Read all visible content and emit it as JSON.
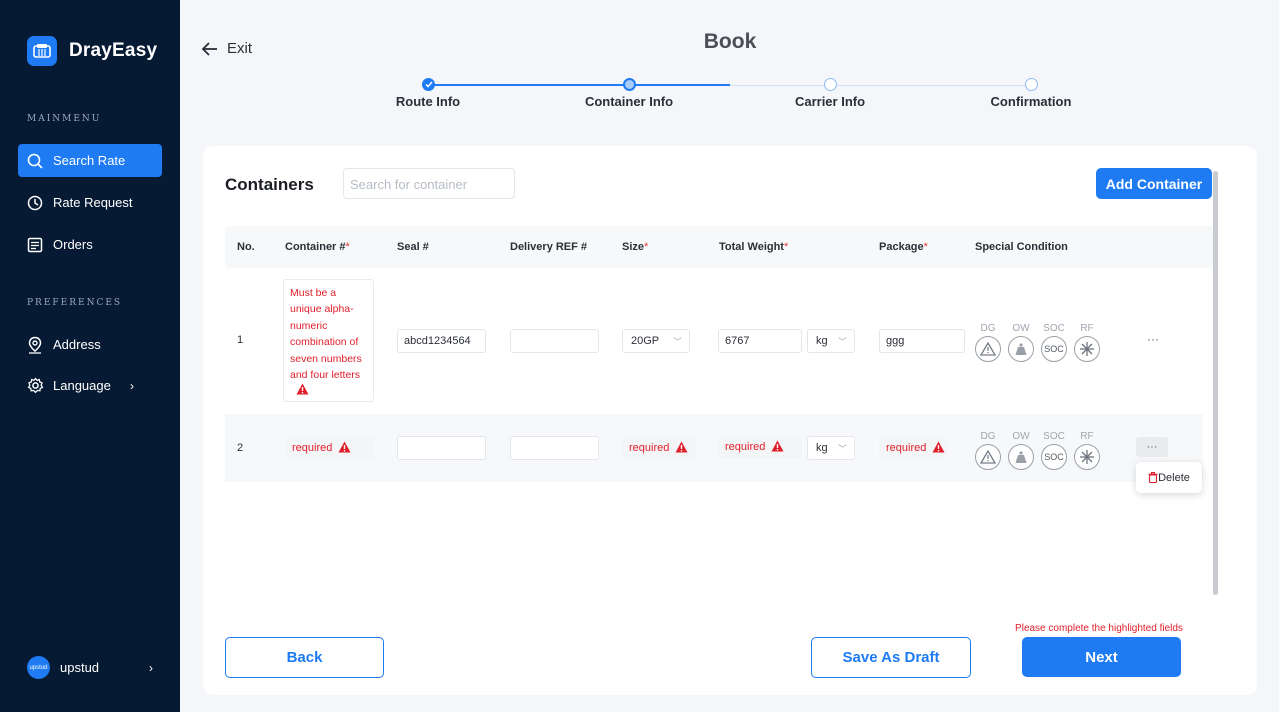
{
  "brand": {
    "name": "DrayEasy"
  },
  "sidebar": {
    "main_menu_title": "MAINMENU",
    "main_items": [
      {
        "label": "Search Rate",
        "icon": "search-icon",
        "active": true
      },
      {
        "label": "Rate Request",
        "icon": "history-icon"
      },
      {
        "label": "Orders",
        "icon": "orders-icon"
      }
    ],
    "preferences_title": "PREFERENCES",
    "pref_items": [
      {
        "label": "Address",
        "icon": "location-icon"
      },
      {
        "label": "Language",
        "icon": "gear-icon"
      }
    ],
    "user": {
      "avatar_text": "upstud",
      "name": "upstud"
    }
  },
  "header": {
    "exit_label": "Exit",
    "title": "Book"
  },
  "stepper": {
    "steps": [
      {
        "label": "Route Info",
        "status": "done"
      },
      {
        "label": "Container Info",
        "status": "current"
      },
      {
        "label": "Carrier Info",
        "status": "pending"
      },
      {
        "label": "Confirmation",
        "status": "pending"
      }
    ]
  },
  "containers": {
    "title": "Containers",
    "search_placeholder": "Search for container",
    "add_button": "Add Container",
    "columns": {
      "no": "No.",
      "container": "Container #",
      "seal": "Seal #",
      "delivery_ref": "Delivery REF #",
      "size": "Size",
      "total_weight": "Total Weight",
      "package": "Package",
      "special": "Special Condition",
      "required_mark": "*"
    },
    "special_labels": {
      "dg": "DG",
      "ow": "OW",
      "soc": "SOC",
      "rf": "RF"
    },
    "rows": [
      {
        "no": "1",
        "container_error": "Must be a unique alpha-numeric combination of seven numbers and four letters",
        "seal": "abcd1234564",
        "delivery_ref": "",
        "size": "20GP",
        "weight": "6767",
        "weight_unit": "kg",
        "package": "ggg",
        "more": "···"
      },
      {
        "no": "2",
        "container_error": "required",
        "seal": "",
        "delivery_ref": "",
        "size_error": "required",
        "weight_error": "required",
        "weight_unit": "kg",
        "package_error": "required",
        "more": "···",
        "menu_delete": "Delete"
      }
    ]
  },
  "footer": {
    "back": "Back",
    "save_draft": "Save As Draft",
    "next": "Next",
    "hint": "Please complete the highlighted fields"
  },
  "colors": {
    "primary": "#1e7bf3",
    "sidebar_bg": "#071a33",
    "error": "#e01e2a"
  }
}
